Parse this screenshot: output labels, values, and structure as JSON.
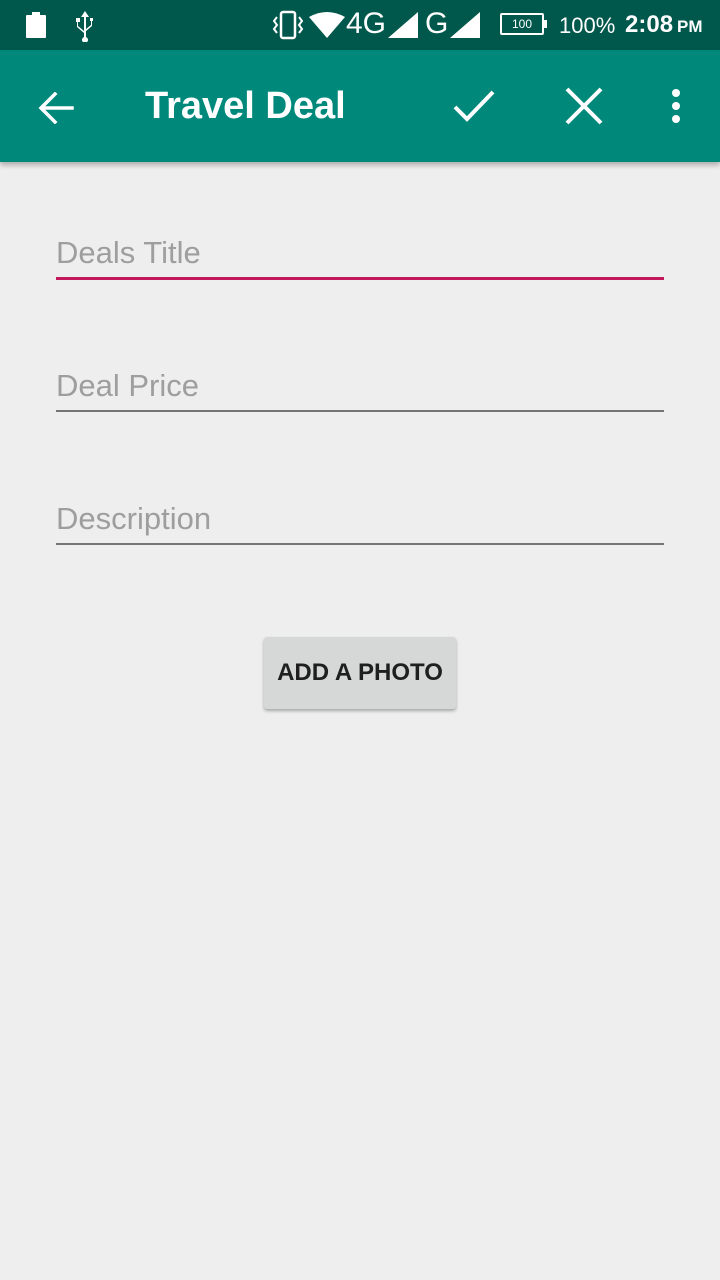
{
  "status_bar": {
    "network_4g": "4G",
    "network_g": "G",
    "battery_level": "100",
    "battery_percent": "100%",
    "time": "2:08",
    "ampm": "PM",
    "icons": [
      "battery-icon",
      "usb-icon",
      "vibrate-icon",
      "wifi-icon",
      "signal-icon",
      "signal-icon"
    ]
  },
  "app_bar": {
    "title": "Travel Deal",
    "icons": [
      "back-arrow-icon",
      "check-icon",
      "close-icon",
      "more-vert-icon"
    ]
  },
  "form": {
    "title_placeholder": "Deals Title",
    "title_value": "",
    "price_placeholder": "Deal Price",
    "price_value": "",
    "description_placeholder": "Description",
    "description_value": "",
    "photo_button_label": "ADD A PHOTO"
  },
  "colors": {
    "status_bar": "#00574b",
    "app_bar": "#00897b",
    "accent": "#c2185b",
    "background": "#eeeeee"
  }
}
